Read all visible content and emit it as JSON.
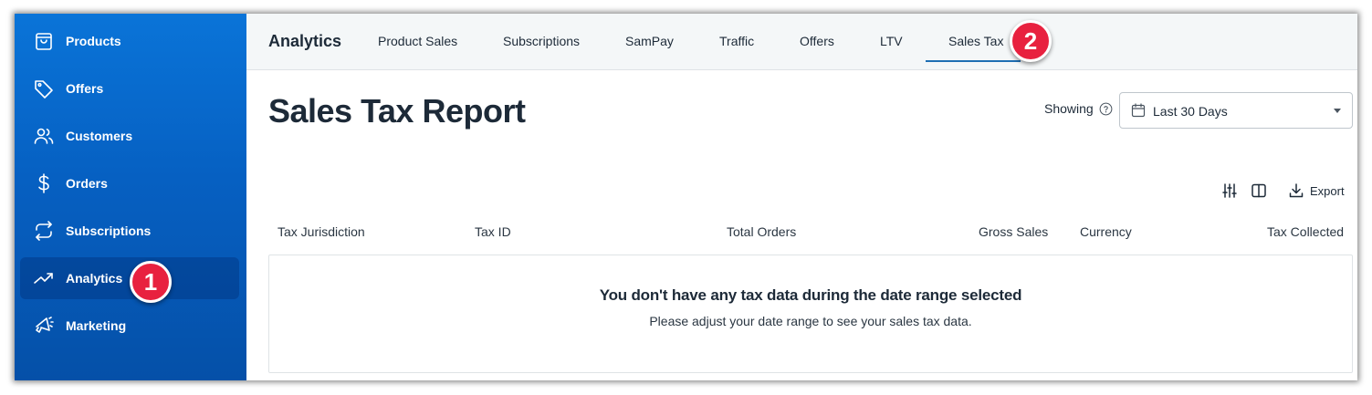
{
  "sidebar": {
    "items": [
      {
        "label": "Products",
        "icon": "shopping-bag-icon"
      },
      {
        "label": "Offers",
        "icon": "tag-icon"
      },
      {
        "label": "Customers",
        "icon": "users-icon"
      },
      {
        "label": "Orders",
        "icon": "dollar-icon"
      },
      {
        "label": "Subscriptions",
        "icon": "repeat-icon"
      },
      {
        "label": "Analytics",
        "icon": "trending-up-icon",
        "active": true
      },
      {
        "label": "Marketing",
        "icon": "megaphone-icon"
      }
    ]
  },
  "badges": {
    "one": "1",
    "two": "2",
    "color": "#e8213f"
  },
  "header": {
    "brand": "Analytics",
    "tabs": [
      {
        "label": "Product Sales"
      },
      {
        "label": "Subscriptions"
      },
      {
        "label": "SamPay"
      },
      {
        "label": "Traffic"
      },
      {
        "label": "Offers"
      },
      {
        "label": "LTV"
      },
      {
        "label": "Sales Tax",
        "active": true
      }
    ]
  },
  "main": {
    "title": "Sales Tax Report",
    "showing_label": "Showing",
    "date_range": {
      "value": "Last 30 Days"
    },
    "toolbar": {
      "export_label": "Export"
    },
    "table": {
      "columns": [
        "Tax Jurisdiction",
        "Tax ID",
        "Total Orders",
        "Gross Sales",
        "Currency",
        "Tax Collected"
      ]
    },
    "empty_state": {
      "title": "You don't have any tax data during the date range selected",
      "subtitle": "Please adjust your date range to see your sales tax data."
    }
  },
  "colors": {
    "sidebar": "#0a6bd0",
    "accent": "#1f6fb3",
    "badge": "#e8213f"
  }
}
